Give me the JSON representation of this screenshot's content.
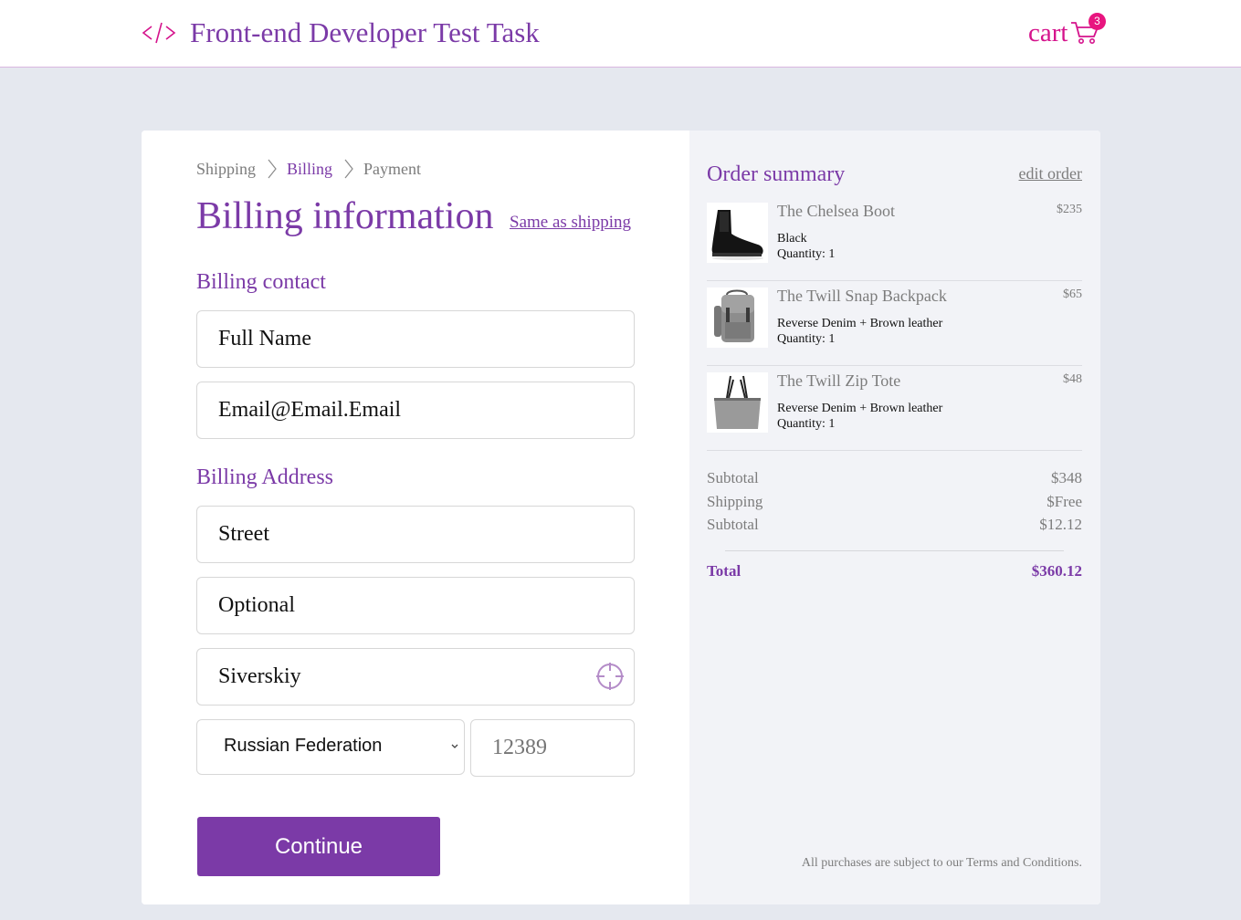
{
  "header": {
    "title": "Front-end Developer Test Task",
    "cart_label": "cart",
    "cart_count": "3"
  },
  "breadcrumb": {
    "step1": "Shipping",
    "step2": "Billing",
    "step3": "Payment"
  },
  "billing": {
    "title": "Billing information",
    "same_as_shipping": "Same as shipping",
    "contact_label": "Billing contact",
    "full_name_placeholder": "Full Name",
    "email_placeholder": "Email@Email.Email",
    "address_label": "Billing Address",
    "street_placeholder": "Street",
    "optional_placeholder": "Optional",
    "city_placeholder": "Siverskiy",
    "country_value": "Russian Federation",
    "zip_placeholder": "12389",
    "continue_label": "Continue"
  },
  "summary": {
    "title": "Order summary",
    "edit_order": "edit order",
    "items": [
      {
        "name": "The Chelsea Boot",
        "price": "$235",
        "variant": "Black",
        "quantity": "Quantity: 1",
        "icon": "boot-image"
      },
      {
        "name": "The Twill Snap Backpack",
        "price": "$65",
        "variant": "Reverse Denim + Brown leather",
        "quantity": "Quantity: 1",
        "icon": "backpack-image"
      },
      {
        "name": "The Twill Zip Tote",
        "price": "$48",
        "variant": "Reverse Denim + Brown leather",
        "quantity": "Quantity: 1",
        "icon": "tote-image"
      }
    ],
    "subtotal_label": "Subtotal",
    "subtotal_value": "$348",
    "shipping_label": "Shipping",
    "shipping_value": "$Free",
    "tax_label": "Subtotal",
    "tax_value": "$12.12",
    "total_label": "Total",
    "total_value": "$360.12",
    "terms_prefix": "All purchases are subject to our ",
    "terms_link": "Terms and Conditions",
    "terms_suffix": "."
  },
  "colors": {
    "accent": "#7b3aa7",
    "cart": "#d5138c",
    "badge": "#e8157f",
    "background": "#e5e8ef",
    "summary_bg": "#f2f3f7"
  }
}
